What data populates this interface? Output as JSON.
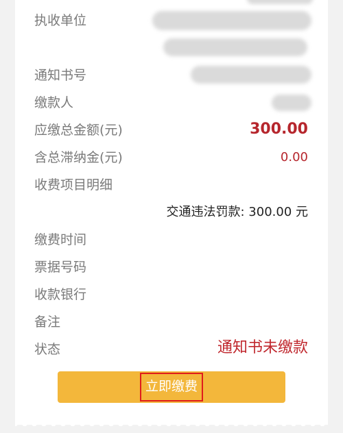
{
  "fields": {
    "unit_label": "执收单位",
    "notice_no_label": "通知书号",
    "payer_label": "缴款人",
    "total_label": "应缴总金额(元)",
    "total_value": "300.00",
    "late_fee_label": "含总滞纳金(元)",
    "late_fee_value": "0.00",
    "items_label": "收费项目明细",
    "item_detail": "交通违法罚款: 300.00 元",
    "pay_time_label": "缴费时间",
    "receipt_no_label": "票据号码",
    "bank_label": "收款银行",
    "remark_label": "备注",
    "status_label": "状态",
    "status_value": "通知书未缴款"
  },
  "pay_button": {
    "label": "立即缴费"
  },
  "colors": {
    "accent_red": "#b6262d",
    "button_yellow": "#f3b73b",
    "label_gray": "#7a7a7a"
  }
}
